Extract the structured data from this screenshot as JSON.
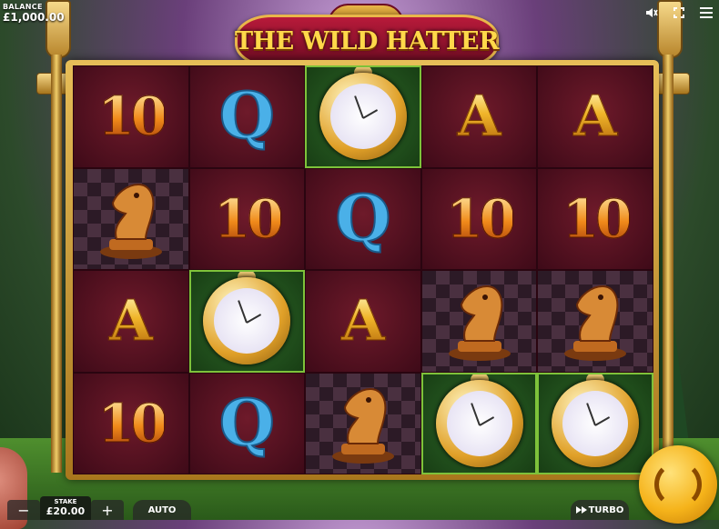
{
  "hud": {
    "balance_label": "BALANCE",
    "balance_value": "£1,000.00"
  },
  "top_icons": [
    "sound-off-icon",
    "fullscreen-icon",
    "menu-icon"
  ],
  "game": {
    "title": "THE WILD HATTER"
  },
  "reels": [
    [
      "10",
      "Q",
      "wild-watch",
      "A",
      "A"
    ],
    [
      "knight",
      "10",
      "Q",
      "10",
      "10"
    ],
    [
      "A",
      "wild-watch",
      "A",
      "knight",
      "knight"
    ],
    [
      "10",
      "Q",
      "knight",
      "wild-watch",
      "wild-watch"
    ]
  ],
  "controls": {
    "minus": "−",
    "stake_label": "STAKE",
    "stake_value": "£20.00",
    "plus": "+",
    "auto_label": "AUTO",
    "turbo_label": "TURBO"
  },
  "colors": {
    "gold": "#e9b64a",
    "reel_bg": "#4e0f20",
    "wild_border": "#7ec23a",
    "spin": "#f5b31a"
  }
}
